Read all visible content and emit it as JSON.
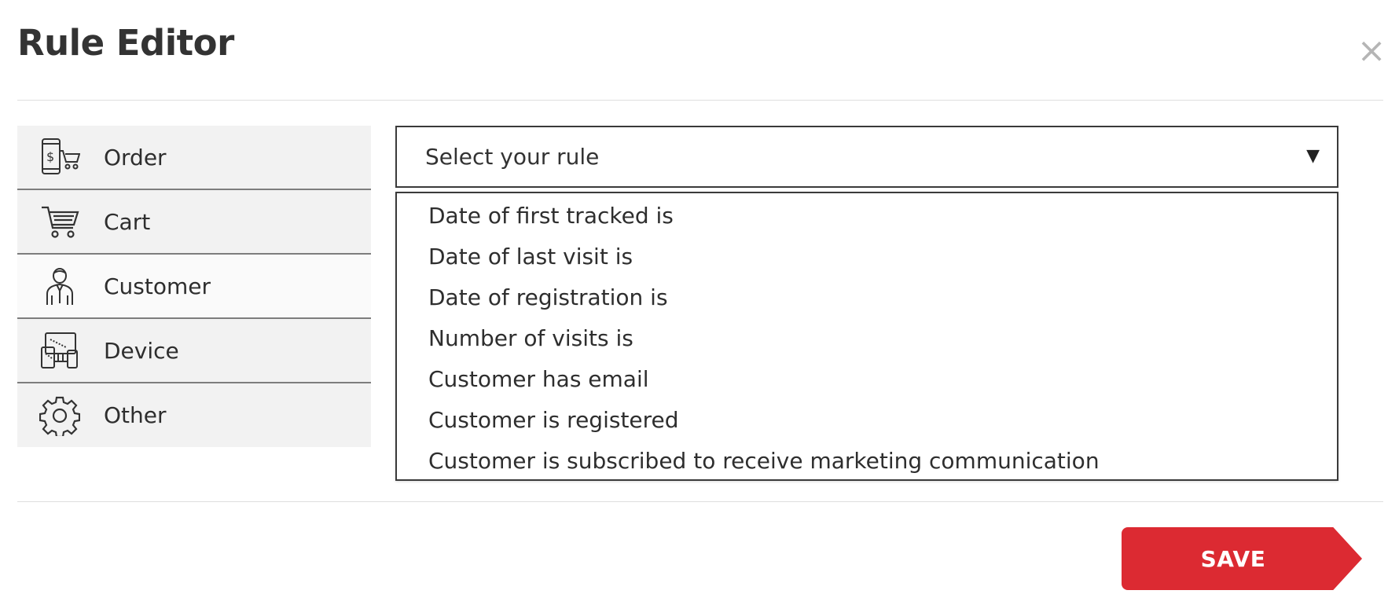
{
  "header": {
    "title": "Rule Editor",
    "close_glyph": "×",
    "close_icon": "close-icon"
  },
  "sidebar": {
    "items": [
      {
        "label": "Order",
        "icon": "order-icon"
      },
      {
        "label": "Cart",
        "icon": "cart-icon"
      },
      {
        "label": "Customer",
        "icon": "customer-icon"
      },
      {
        "label": "Device",
        "icon": "device-icon"
      },
      {
        "label": "Other",
        "icon": "gear-icon"
      }
    ]
  },
  "rule_select": {
    "placeholder": "Select your rule",
    "arrow_glyph": "▼",
    "options": [
      "Date of first tracked is",
      "Date of last visit is",
      "Date of registration is",
      "Number of visits is",
      "Customer has email",
      "Customer is registered",
      "Customer is subscribed to receive marketing communication"
    ]
  },
  "footer": {
    "save_label": "SAVE"
  },
  "colors": {
    "accent": "#dc2a32",
    "sidebar_bg": "#f2f2f2",
    "border": "#3a3a3a"
  }
}
